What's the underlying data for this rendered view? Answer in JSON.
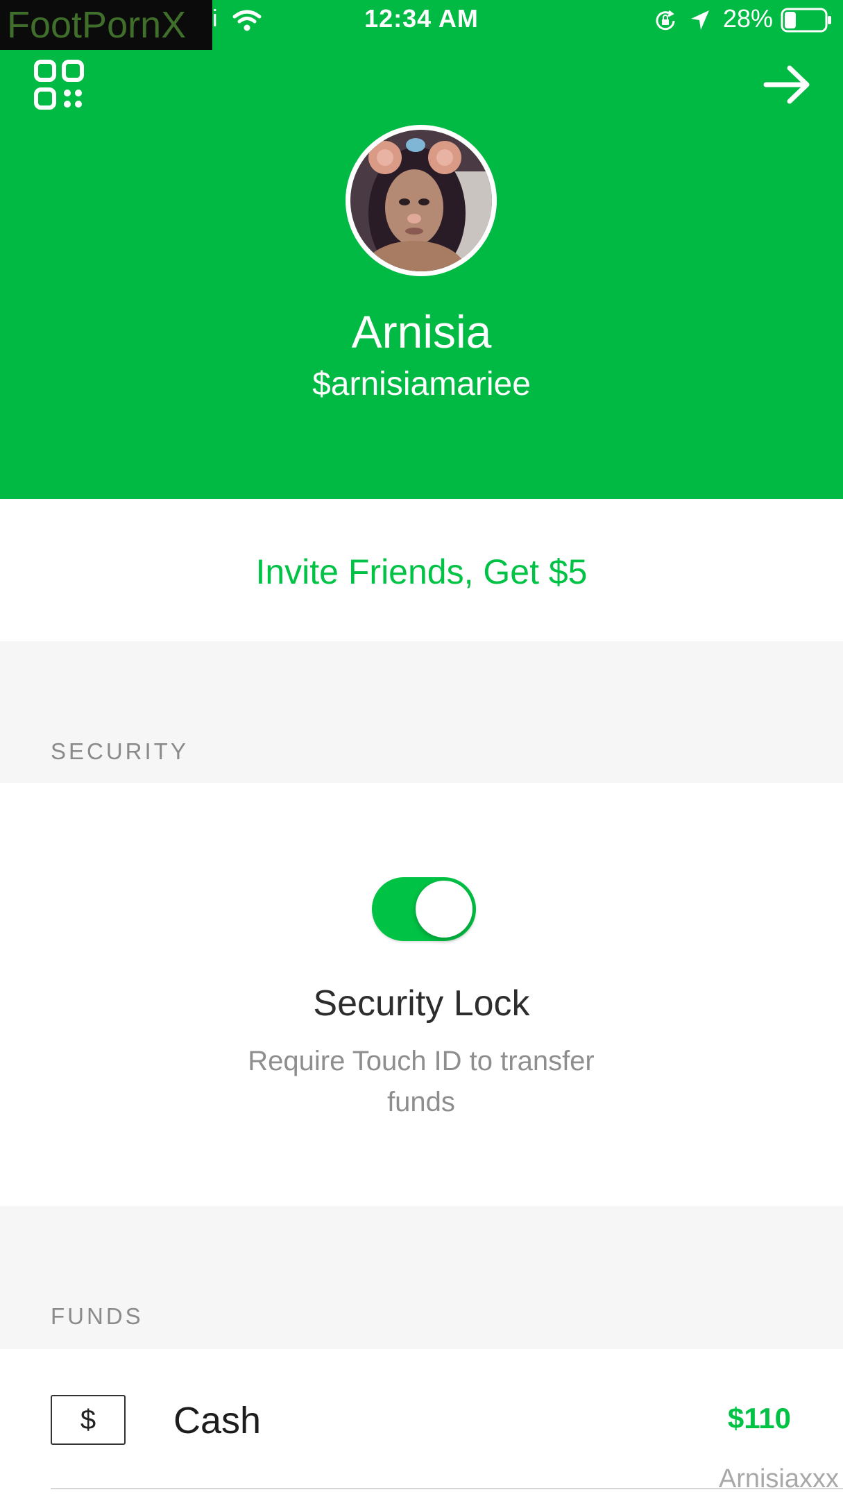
{
  "colors": {
    "brand_green": "#00BA43",
    "accent_green": "#00C244",
    "section_gray": "#f6f6f6"
  },
  "watermarks": {
    "top_left": "FootPornX",
    "bottom_right": "Arnisiaxxx"
  },
  "status_bar": {
    "carrier_fragment": "i",
    "time": "12:34 AM",
    "battery_percent": "28%",
    "battery_level": 0.28,
    "icons": [
      "wifi-icon",
      "orientation-lock-icon",
      "location-arrow-icon",
      "battery-icon"
    ]
  },
  "header": {
    "left_icon": "qr-code-icon",
    "right_icon": "arrow-right-icon",
    "avatar": "profile-photo",
    "name": "Arnisia",
    "cashtag": "$arnisiamariee"
  },
  "invite": {
    "label": "Invite Friends, Get $5"
  },
  "security": {
    "heading": "SECURITY",
    "toggle_on": true,
    "title": "Security Lock",
    "description": "Require Touch ID to transfer funds"
  },
  "funds": {
    "heading": "FUNDS",
    "items": [
      {
        "icon_symbol": "$",
        "label": "Cash",
        "amount": "$110"
      }
    ]
  }
}
